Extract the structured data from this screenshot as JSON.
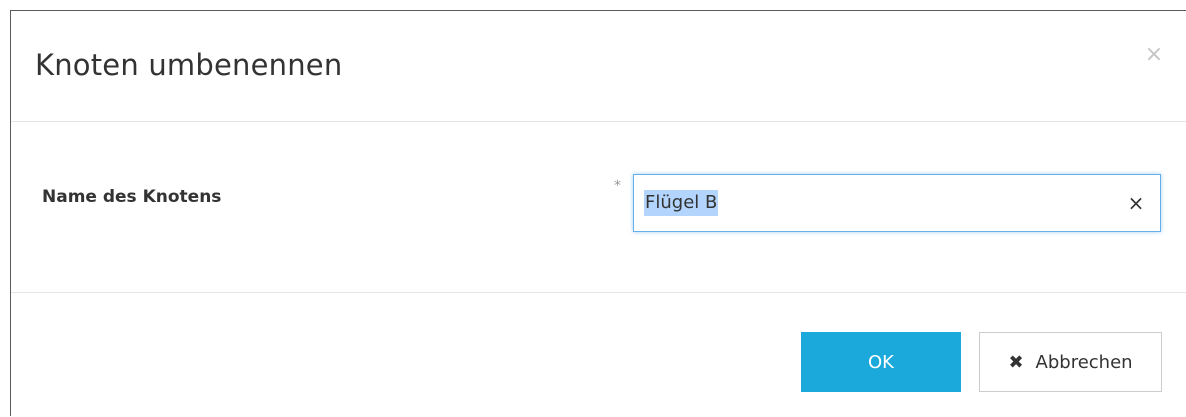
{
  "dialog": {
    "title": "Knoten umbenennen",
    "close_icon": "×"
  },
  "form": {
    "field_label": "Name des Knotens",
    "required_mark": "*",
    "value": "Flügel B",
    "clear_icon": "×"
  },
  "footer": {
    "ok_label": "OK",
    "cancel_icon": "✖",
    "cancel_label": "Abbrechen"
  },
  "colors": {
    "primary": "#1ba9dc",
    "focus_border": "#66afe9",
    "selection": "#b3d4fc"
  }
}
